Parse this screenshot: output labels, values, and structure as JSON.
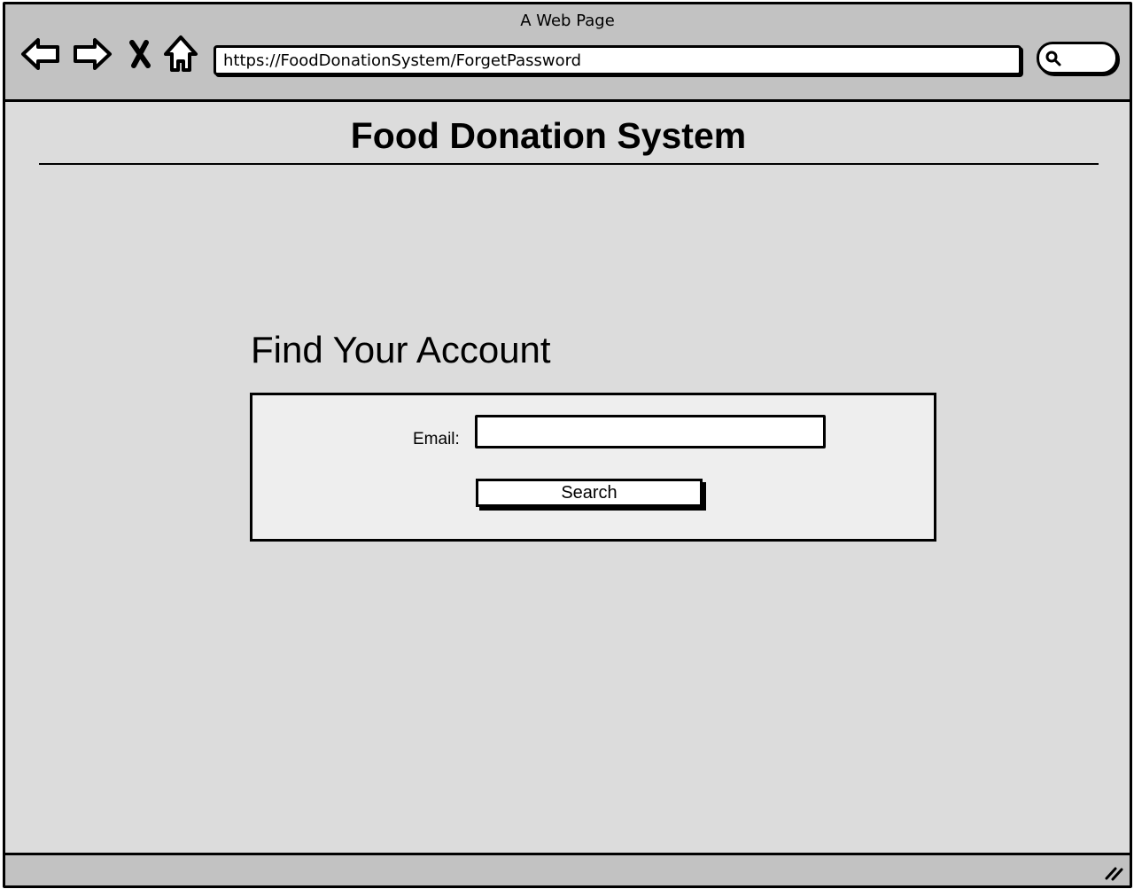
{
  "window": {
    "title": "A Web Page"
  },
  "browser": {
    "url": "https://FoodDonationSystem/ForgetPassword"
  },
  "page": {
    "heading": "Food Donation System",
    "section_title": "Find Your Account",
    "form": {
      "email_label": "Email:",
      "email_value": "",
      "search_label": "Search"
    }
  },
  "icons": {
    "back": "back-arrow-icon",
    "forward": "forward-arrow-icon",
    "stop": "close-icon",
    "home": "home-icon",
    "search": "search-icon",
    "resize": "resize-grip-icon"
  },
  "colors": {
    "chrome": "#c2c2c2",
    "content": "#dcdcdc",
    "panel": "#eeeeee",
    "ink": "#000000"
  }
}
